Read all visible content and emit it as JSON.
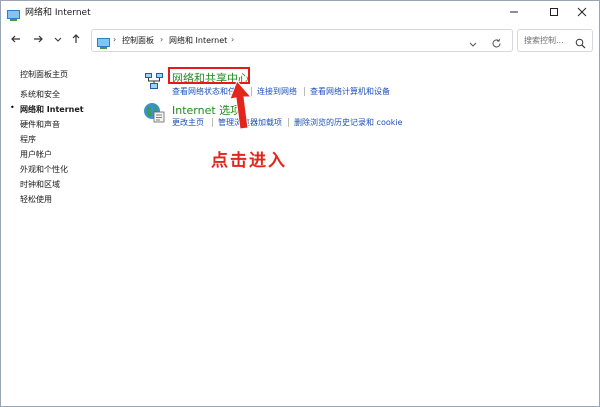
{
  "window": {
    "title": "网络和 Internet",
    "controls": {
      "minimize": "minimize-icon",
      "maximize": "maximize-icon",
      "close": "close-icon"
    }
  },
  "nav": {
    "back": "back-arrow-icon",
    "forward": "forward-arrow-icon",
    "recent": "chevron-down-icon",
    "up": "up-arrow-icon"
  },
  "address": {
    "crumbs": [
      "控制面板",
      "网络和 Internet"
    ],
    "separator": "›"
  },
  "search": {
    "placeholder": "搜索控制..."
  },
  "sidebar": {
    "items": [
      {
        "label": "控制面板主页",
        "active": false
      },
      {
        "label": "系统和安全",
        "active": false
      },
      {
        "label": "网络和 Internet",
        "active": true
      },
      {
        "label": "硬件和声音",
        "active": false
      },
      {
        "label": "程序",
        "active": false
      },
      {
        "label": "用户帐户",
        "active": false
      },
      {
        "label": "外观和个性化",
        "active": false
      },
      {
        "label": "时钟和区域",
        "active": false
      },
      {
        "label": "轻松使用",
        "active": false
      }
    ],
    "bullet": "•"
  },
  "categories": [
    {
      "title": "网络和共享中心",
      "icon": "network-sharing-icon",
      "links": [
        "查看网络状态和任务",
        "连接到网络",
        "查看网络计算机和设备"
      ]
    },
    {
      "title": "Internet 选项",
      "icon": "internet-options-icon",
      "links": [
        "更改主页",
        "管理浏览器加载项",
        "删除浏览的历史记录和 cookie"
      ]
    }
  ],
  "annotation": {
    "text": "点击进入",
    "color": "#e3261b"
  },
  "colors": {
    "link": "#1c4fb8",
    "category_title": "#1f8a1f",
    "highlight": "#e31b1b"
  }
}
